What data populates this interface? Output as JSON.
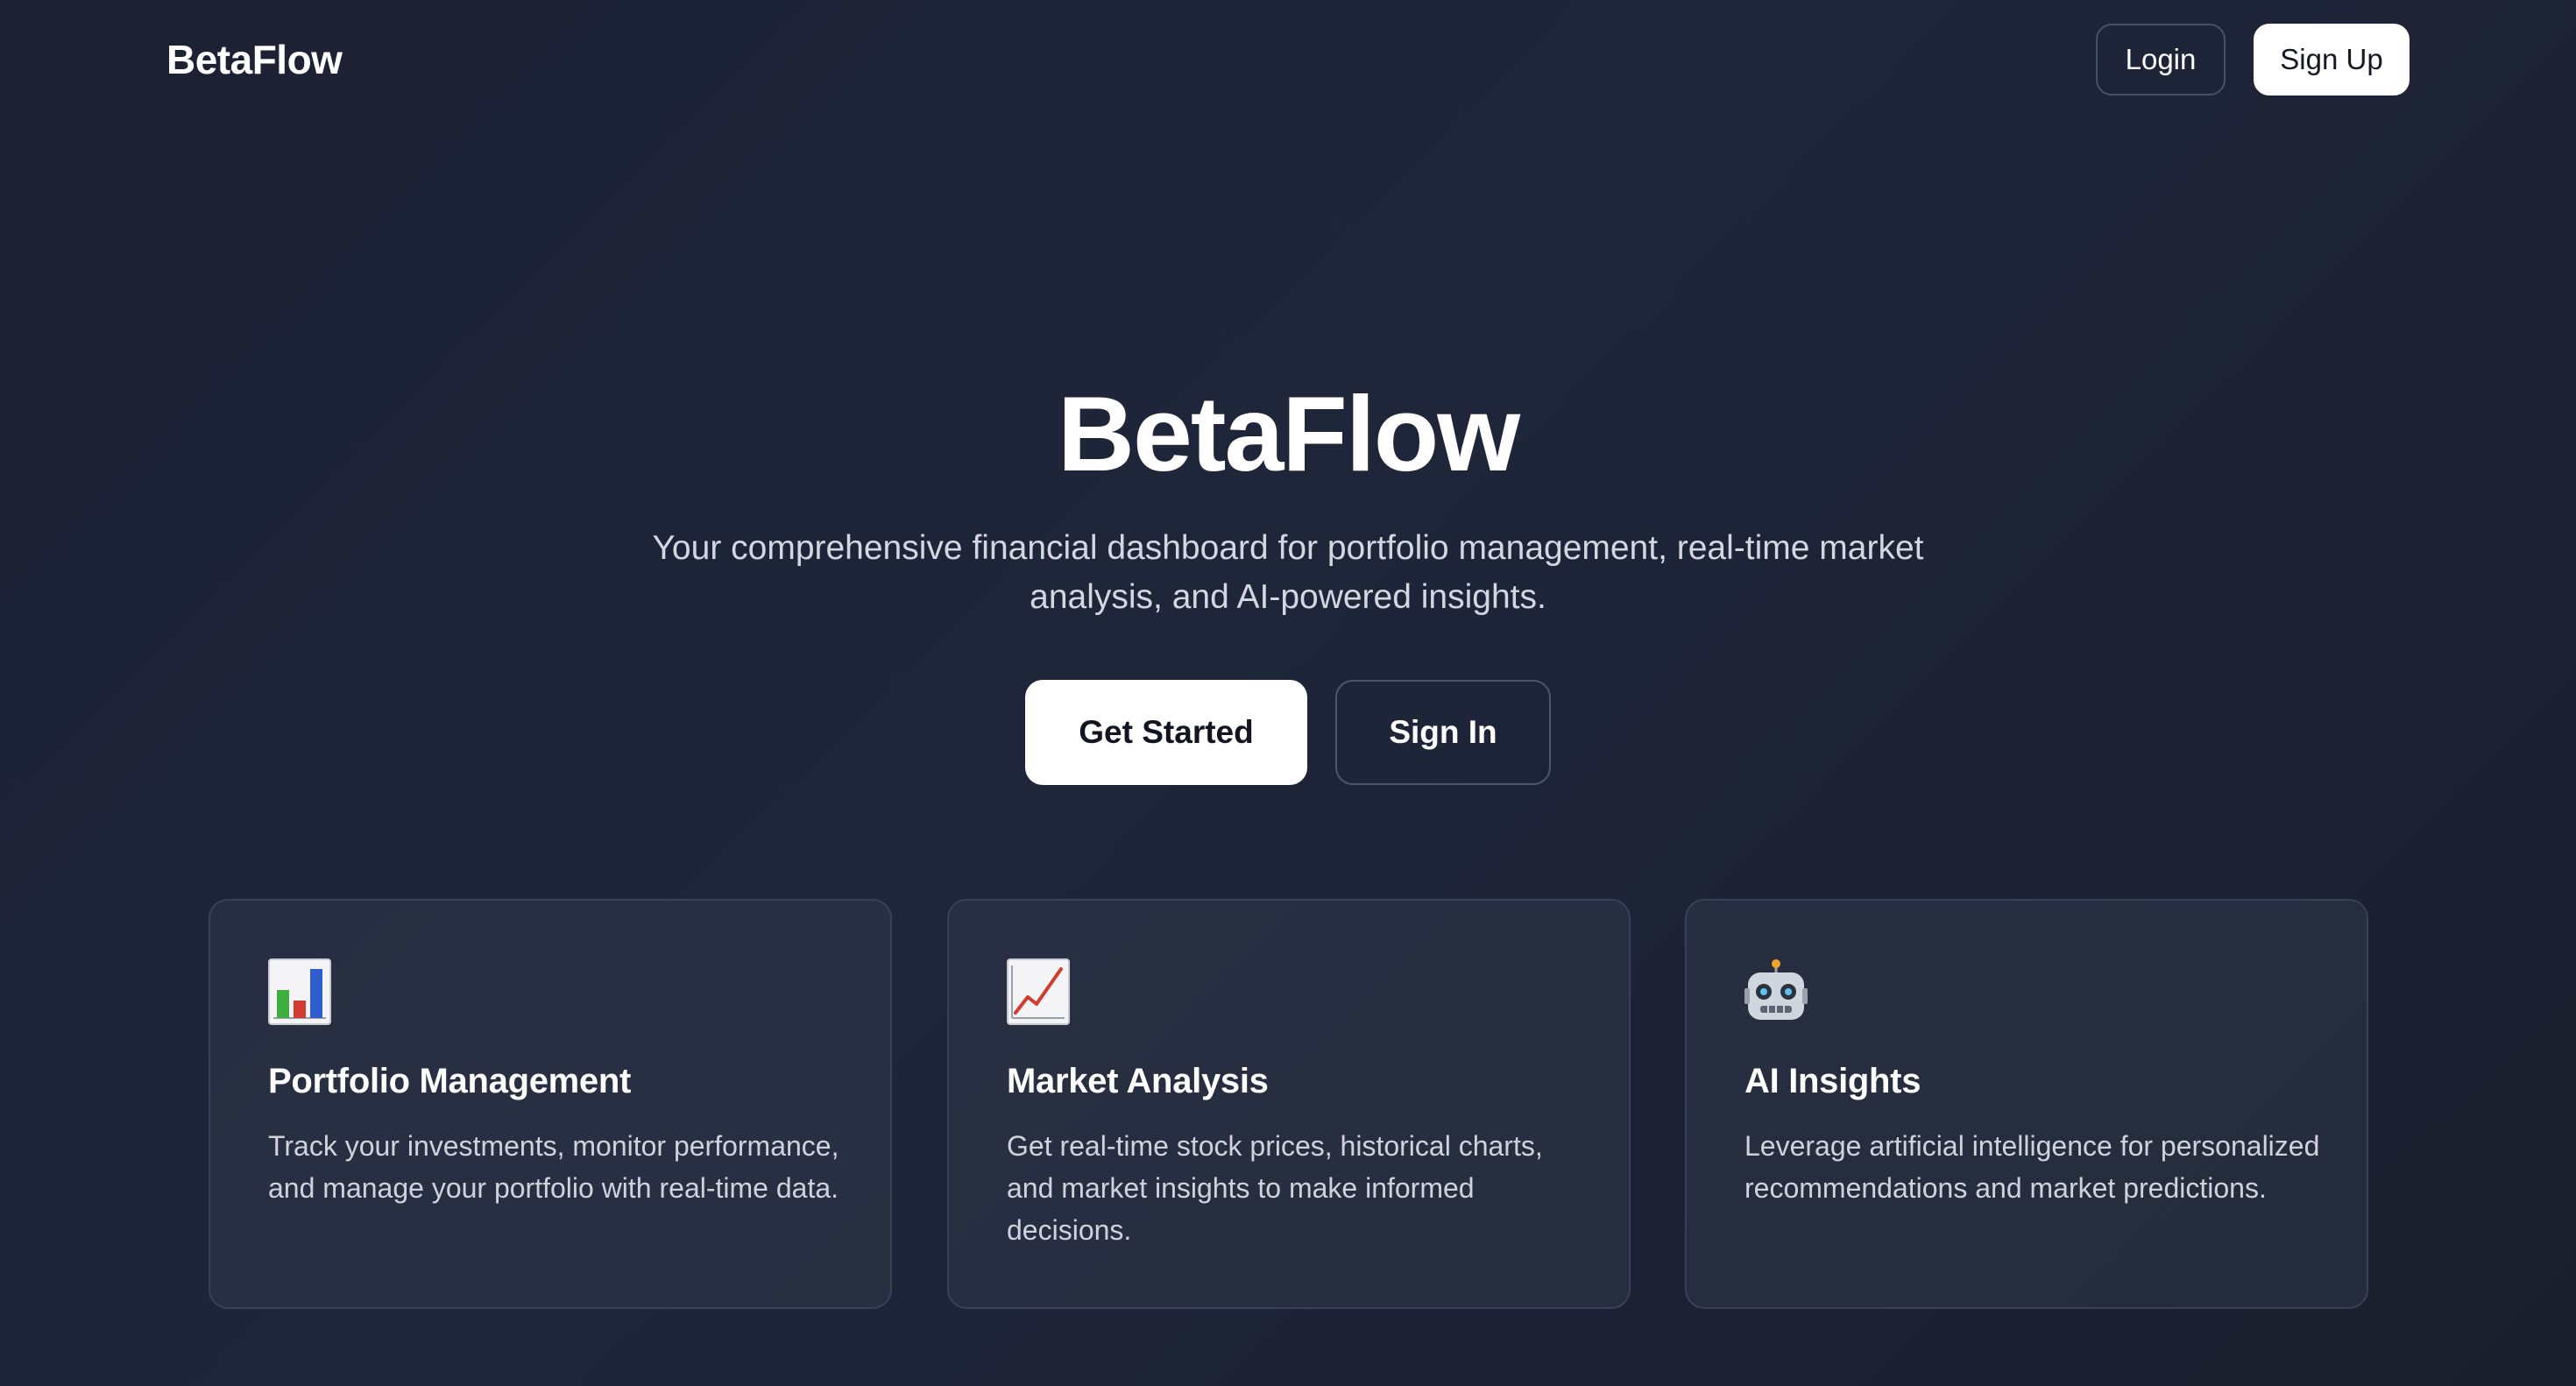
{
  "nav": {
    "brand": "BetaFlow",
    "login_label": "Login",
    "signup_label": "Sign Up"
  },
  "hero": {
    "title": "BetaFlow",
    "subtitle": "Your comprehensive financial dashboard for portfolio management, real-time market analysis, and AI-powered insights.",
    "primary_cta": "Get Started",
    "secondary_cta": "Sign In"
  },
  "features": [
    {
      "icon": "bar-chart-icon",
      "title": "Portfolio Management",
      "description": "Track your investments, monitor performance, and manage your portfolio with real-time data."
    },
    {
      "icon": "chart-increasing-icon",
      "title": "Market Analysis",
      "description": "Get real-time stock prices, historical charts, and market insights to make informed decisions."
    },
    {
      "icon": "robot-icon",
      "title": "AI Insights",
      "description": "Leverage artificial intelligence for personalized recommendations and market predictions."
    }
  ],
  "colors": {
    "background": "#1f263a",
    "card_border": "#3a4154",
    "button_primary": "#ffffff",
    "text_muted": "#cfd3dc"
  }
}
